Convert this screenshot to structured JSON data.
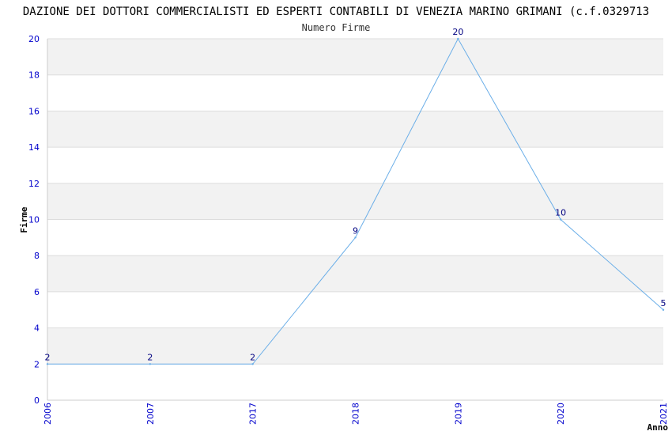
{
  "chart_data": {
    "type": "line",
    "title": "DAZIONE DEI DOTTORI COMMERCIALISTI ED ESPERTI CONTABILI DI VENEZIA MARINO GRIMANI (c.f.0329713",
    "subtitle": "Numero Firme",
    "xlabel": "Anno",
    "ylabel": "Firme",
    "categories": [
      "2006",
      "2007",
      "2017",
      "2018",
      "2019",
      "2020",
      "2021"
    ],
    "series": [
      {
        "values": [
          2,
          2,
          2,
          9,
          20,
          10,
          5
        ]
      }
    ],
    "data_labels": [
      "2",
      "2",
      "2",
      "9",
      "20",
      "10",
      "5"
    ],
    "ylim": [
      0,
      20
    ],
    "yticks": [
      0,
      2,
      4,
      6,
      8,
      10,
      12,
      14,
      16,
      18,
      20
    ],
    "ytick_labels": [
      "0",
      "2",
      "4",
      "6",
      "8",
      "10",
      "12",
      "14",
      "16",
      "18",
      "20"
    ],
    "grid": true,
    "colors": {
      "line": "#6aaee8",
      "band": "#f2f2f2",
      "grid": "#dddddd",
      "tick_text": "#0000cc",
      "data_label": "#000080"
    }
  }
}
